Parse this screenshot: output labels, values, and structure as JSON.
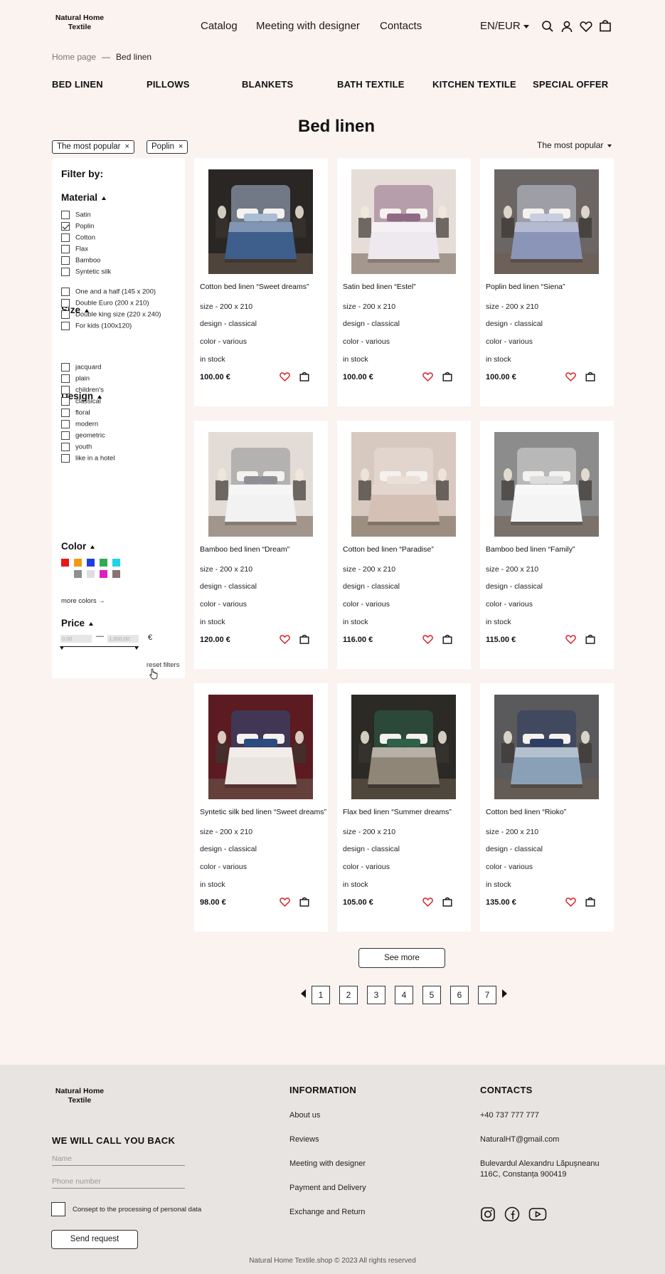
{
  "header": {
    "logo_line1": "Natural Home",
    "logo_line2": "Textile",
    "nav": [
      "Catalog",
      "Meeting with designer",
      "Contacts"
    ],
    "lang": "EN/EUR",
    "icons": [
      "search-icon",
      "user-icon",
      "heart-icon",
      "bag-icon"
    ]
  },
  "breadcrumb": {
    "home": "Home page",
    "sep": "—",
    "current": "Bed linen"
  },
  "categories": [
    "BED LINEN",
    "PILLOWS",
    "BLANKETS",
    "BATH TEXTILE",
    "KITCHEN TEXTILE",
    "SPECIAL OFFER"
  ],
  "page_title": "Bed linen",
  "chips": [
    {
      "label": "The most popular",
      "x": "×"
    },
    {
      "label": "Poplin",
      "x": "×"
    }
  ],
  "sort": {
    "label": "The most popular"
  },
  "filter": {
    "heading": "Filter by:",
    "material": {
      "title": "Material",
      "items": [
        {
          "label": "Satin",
          "checked": false
        },
        {
          "label": "Poplin",
          "checked": true
        },
        {
          "label": "Cotton",
          "checked": false
        },
        {
          "label": "Flax",
          "checked": false
        },
        {
          "label": "Bamboo",
          "checked": false
        },
        {
          "label": "Syntetic silk",
          "checked": false
        }
      ]
    },
    "size": {
      "title": "Size",
      "items": [
        {
          "label": "One and a half (145 x 200)",
          "checked": false
        },
        {
          "label": "Double Euro (200 x 210)",
          "checked": false
        },
        {
          "label": "Double king size (220 x 240)",
          "checked": false
        },
        {
          "label": "For kids (100x120)",
          "checked": false
        }
      ]
    },
    "design": {
      "title": "Design",
      "items": [
        {
          "label": "jacquard",
          "checked": false
        },
        {
          "label": "plain",
          "checked": false
        },
        {
          "label": "children's",
          "checked": false
        },
        {
          "label": "classical",
          "checked": false
        },
        {
          "label": "floral",
          "checked": false
        },
        {
          "label": "modern",
          "checked": false
        },
        {
          "label": "geometric",
          "checked": false
        },
        {
          "label": "youth",
          "checked": false
        },
        {
          "label": "like in a hotel",
          "checked": false
        }
      ]
    },
    "color": {
      "title": "Color",
      "swatches_row1": [
        "#e8161b",
        "#f29a14",
        "#1d3fe0",
        "#2fab55",
        "#1dd5ea"
      ],
      "swatches_row2": [
        "#8f8f8f",
        "#dedede",
        "#e11cc3",
        "#8a7272"
      ],
      "more": "more colors →"
    },
    "price": {
      "title": "Price",
      "min": "0.00",
      "dash": "—",
      "max": "1,000.00",
      "currency": "€"
    },
    "reset": "reset filters"
  },
  "products": [
    {
      "name": "Cotton bed linen “Sweet dreams”",
      "size": "size - 200 x 210",
      "design": "design - classical",
      "color": "color - various",
      "stock": "in stock",
      "price": "100.00 €",
      "wall": "#2a2624",
      "bed": "#3e5f8c",
      "pillow": "#a9bdd5"
    },
    {
      "name": "Satin bed linen “Estel”",
      "size": "size - 200 x 210",
      "design": "design - classical",
      "color": "color - various",
      "stock": "in stock",
      "price": "100.00 €",
      "wall": "#e7ddd8",
      "bed": "#eee9ee",
      "pillow": "#8e6a85"
    },
    {
      "name": "Poplin bed linen “Siena”",
      "size": "size - 200 x 210",
      "design": "design - classical",
      "color": "color - various",
      "stock": "in stock",
      "price": "100.00 €",
      "wall": "#6b6563",
      "bed": "#8b95b8",
      "pillow": "#c9cde0"
    },
    {
      "name": "Bamboo bed linen “Dream”",
      "size": "size - 200 x 210",
      "design": "design - classical",
      "color": "color - various",
      "stock": "in stock",
      "price": "120.00 €",
      "wall": "#e3dcd6",
      "bed": "#f2f2f3",
      "pillow": "#8d8f94"
    },
    {
      "name": "Cotton bed linen “Paradise”",
      "size": "size - 200 x 210",
      "design": "design - classical",
      "color": "color - various",
      "stock": "in stock",
      "price": "116.00 €",
      "wall": "#d7c9bf",
      "bed": "#d4c0b5",
      "pillow": "#ebdfd8"
    },
    {
      "name": "Bamboo bed linen “Family”",
      "size": "size - 200 x 210",
      "design": "design - classical",
      "color": "color - various",
      "stock": "in stock",
      "price": "115.00 €",
      "wall": "#8c8c8c",
      "bed": "#f4f4f4",
      "pillow": "#dcdcdc"
    },
    {
      "name": "Syntetic silk bed linen “Sweet dreams”",
      "size": "size - 200 x 210",
      "design": "design - classical",
      "color": "color - various",
      "stock": "in stock",
      "price": "98.00 €",
      "wall": "#5b1b20",
      "bed": "#e9e4df",
      "pillow": "#2b4c80"
    },
    {
      "name": "Flax bed linen “Summer dreams”",
      "size": "size - 200 x 210",
      "design": "design - classical",
      "color": "color - various",
      "stock": "in stock",
      "price": "105.00 €",
      "wall": "#2b2a25",
      "bed": "#8f8678",
      "pillow": "#2e6148"
    },
    {
      "name": "Cotton bed linen “Rioko”",
      "size": "size - 200 x 210",
      "design": "design - classical",
      "color": "color - various",
      "stock": "in stock",
      "price": "135.00 €",
      "wall": "#5a5a5c",
      "bed": "#8aa0b6",
      "pillow": "#2d3d63"
    }
  ],
  "see_more": "See more",
  "pages": [
    "1",
    "2",
    "3",
    "4",
    "5",
    "6",
    "7"
  ],
  "footer": {
    "logo_line1": "Natural Home",
    "logo_line2": "Textile",
    "callback_title": "WE WILL CALL YOU BACK",
    "name_placeholder": "Name",
    "phone_placeholder": "Phone number",
    "consent": "Consept to the processing of personal data",
    "send": "Send request",
    "info_title": "INFORMATION",
    "info_links": [
      "About us",
      "Reviews",
      "Meeting with designer",
      "Payment and Delivery",
      "Exchange and Return"
    ],
    "contacts_title": "CONTACTS",
    "phone": "+40 737 777 777",
    "email": "NaturalHT@gmail.com",
    "address1": "Bulevardul Alexandru Lăpușneanu",
    "address2": "116C, Constanța 900419",
    "social": [
      "instagram-icon",
      "facebook-icon",
      "youtube-icon"
    ],
    "copyright": "Natural Home Textile.shop © 2023 All rights reserved"
  }
}
